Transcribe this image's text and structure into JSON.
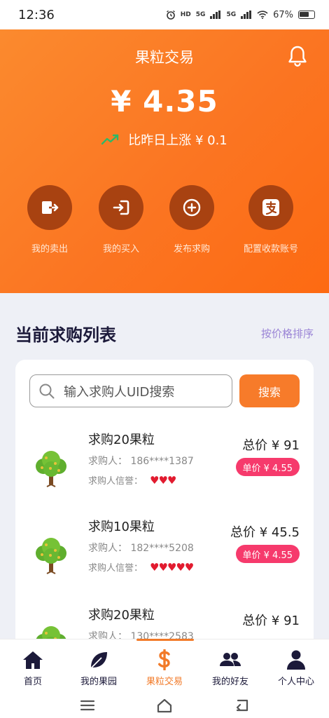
{
  "status": {
    "time": "12:36",
    "net1": "HD",
    "net2": "5G",
    "net3": "5G",
    "battery": "67%"
  },
  "header": {
    "title": "果粒交易",
    "price": "¥ 4.35",
    "change_text": "比昨日上涨 ¥ 0.1"
  },
  "actions": [
    {
      "label": "我的卖出",
      "icon": "sell-out-icon"
    },
    {
      "label": "我的买入",
      "icon": "buy-in-icon"
    },
    {
      "label": "发布求购",
      "icon": "plus-circle-icon"
    },
    {
      "label": "配置收款账号",
      "icon": "alipay-icon"
    }
  ],
  "list": {
    "title": "当前求购列表",
    "sort_label": "按价格排序",
    "search_placeholder": "输入求购人UID搜索",
    "search_button": "搜索",
    "buyer_prefix": "求购人：",
    "rep_prefix": "求购人信誉：",
    "items": [
      {
        "name": "求购20果粒",
        "buyer": "186****1387",
        "hearts": "♥♥♥",
        "total": "总价 ¥ 91",
        "unit": "单价 ¥ 4.55"
      },
      {
        "name": "求购10果粒",
        "buyer": "182****5208",
        "hearts": "♥♥♥♥♥",
        "total": "总价 ¥ 45.5",
        "unit": "单价 ¥ 4.55"
      },
      {
        "name": "求购20果粒",
        "buyer": "130****2583",
        "hearts": "",
        "total": "总价 ¥ 91",
        "unit": ""
      }
    ]
  },
  "tabs": [
    {
      "label": "首页",
      "icon": "home-icon"
    },
    {
      "label": "我的果园",
      "icon": "leaf-icon"
    },
    {
      "label": "果粒交易",
      "icon": "dollar-icon",
      "active": true
    },
    {
      "label": "我的好友",
      "icon": "friends-icon"
    },
    {
      "label": "个人中心",
      "icon": "person-icon"
    }
  ],
  "colors": {
    "accent": "#f77b2a",
    "price_badge": "#f63a6c",
    "dark_circle": "#a84211",
    "heading": "#1c1a3a"
  }
}
